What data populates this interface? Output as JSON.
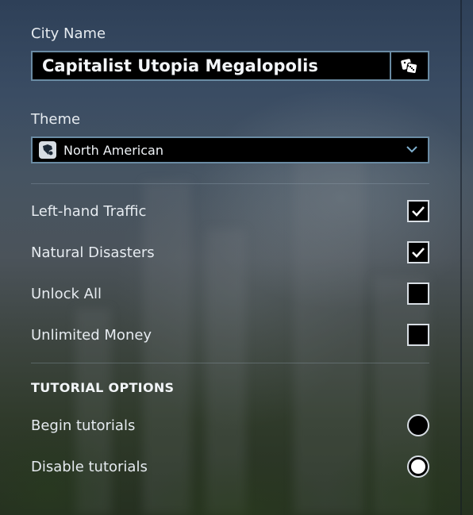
{
  "city_name": {
    "label": "City Name",
    "value": "Capitalist Utopia Megalopolis",
    "randomize_icon": "dice-icon"
  },
  "theme": {
    "label": "Theme",
    "selected": "North American",
    "flag_icon": "north-america-icon",
    "dropdown_icon": "chevron-down-icon"
  },
  "options": [
    {
      "label": "Left-hand Traffic",
      "checked": true
    },
    {
      "label": "Natural Disasters",
      "checked": true
    },
    {
      "label": "Unlock All",
      "checked": false
    },
    {
      "label": "Unlimited Money",
      "checked": false
    }
  ],
  "tutorial": {
    "title": "TUTORIAL OPTIONS",
    "choices": [
      {
        "label": "Begin tutorials",
        "selected": false
      },
      {
        "label": "Disable tutorials",
        "selected": true
      }
    ]
  },
  "colors": {
    "field_border": "#6a8ba3",
    "field_bg": "#000000",
    "text": "#e6ebf0"
  }
}
